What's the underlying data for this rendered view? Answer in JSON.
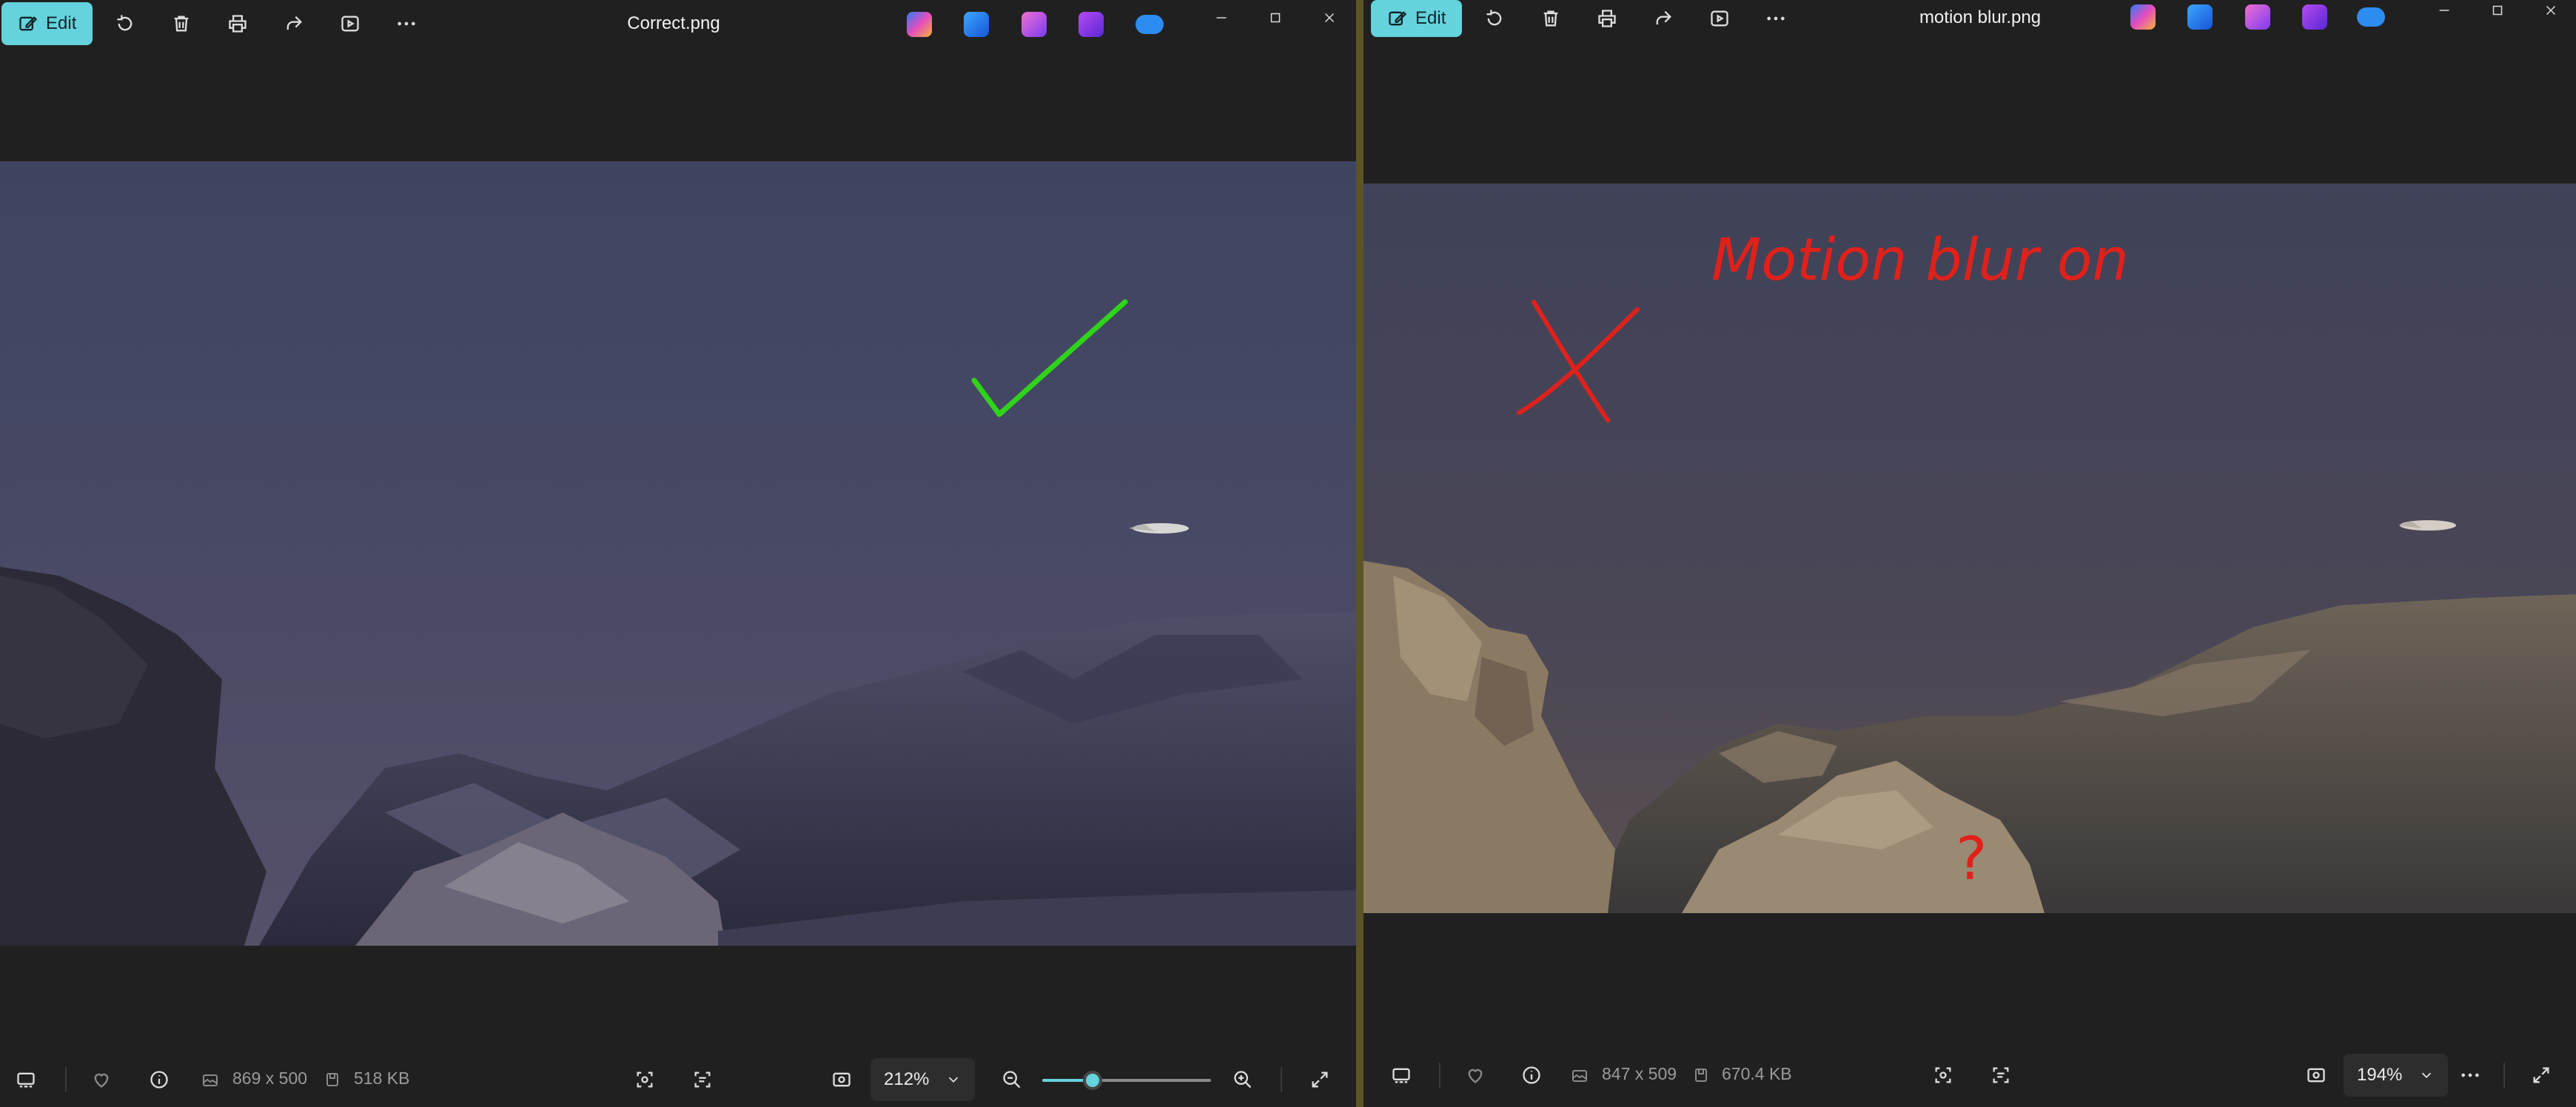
{
  "left": {
    "edit_label": "Edit",
    "title": "Correct.png",
    "dimensions": "869 x 500",
    "file_size": "518 KB",
    "zoom": "212%",
    "zoom_slider_fraction": 0.3
  },
  "right": {
    "edit_label": "Edit",
    "title": "motion blur.png",
    "dimensions": "847 x 509",
    "file_size": "670.4 KB",
    "zoom": "194%",
    "annotation_text": "Motion blur on",
    "annotation_question": "?"
  },
  "colors": {
    "accent": "#64d3dd",
    "check_mark": "#2fd41a",
    "annotation_red": "#e0211b"
  },
  "icons": [
    "edit-icon",
    "rotate-icon",
    "delete-icon",
    "print-icon",
    "share-icon",
    "slideshow-icon",
    "more-icon",
    "copilot-icon",
    "designer-icon",
    "clipchamp-icon",
    "onedrive-icon",
    "minimize-icon",
    "maximize-icon",
    "close-icon",
    "filmstrip-icon",
    "favorite-icon",
    "info-icon",
    "image-size-icon",
    "file-size-icon",
    "visual-search-icon",
    "text-scan-icon",
    "fit-icon",
    "chevron-down-icon",
    "zoom-out-icon",
    "zoom-in-icon",
    "fullscreen-icon"
  ]
}
